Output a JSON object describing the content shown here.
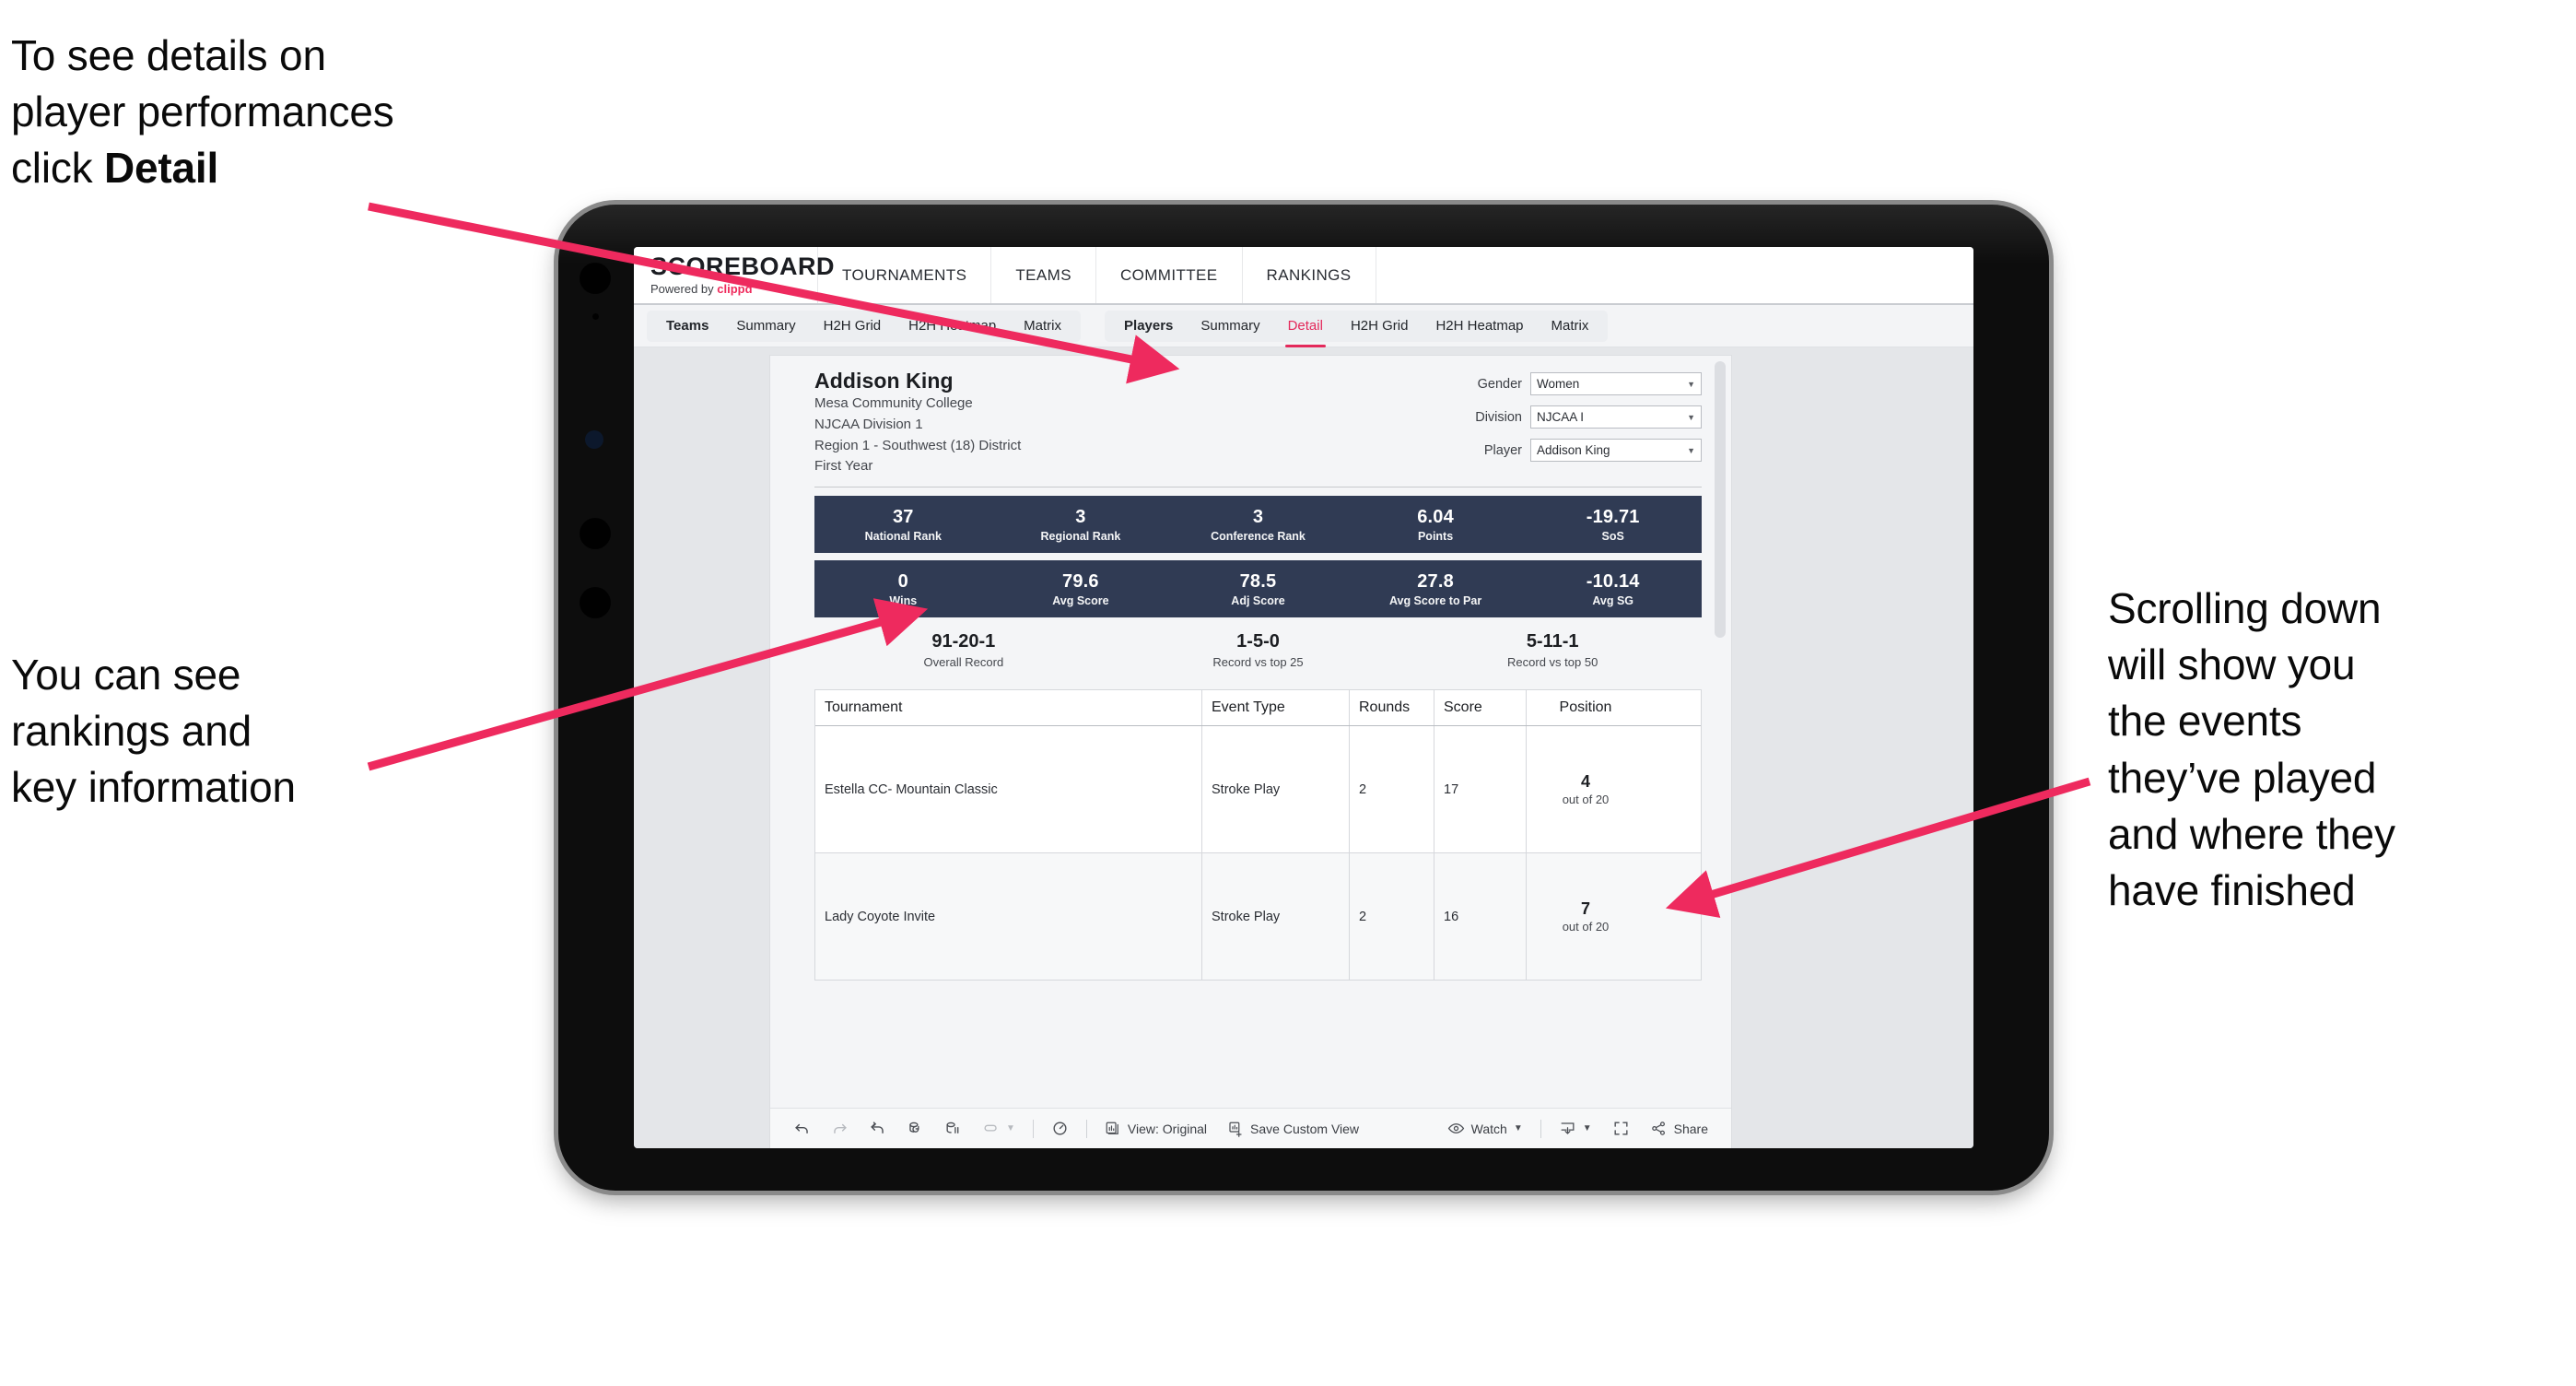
{
  "annotations": {
    "top_left": {
      "line1": "To see details on",
      "line2": "player performances",
      "line3_prefix": "click ",
      "line3_bold": "Detail"
    },
    "mid_left": {
      "line1": "You can see",
      "line2": "rankings and",
      "line3": "key information"
    },
    "right": {
      "line1": "Scrolling down",
      "line2": "will show you",
      "line3": "the events",
      "line4": "they’ve played",
      "line5": "and where they",
      "line6": "have finished"
    }
  },
  "colors": {
    "accent_pink": "#e4295b",
    "annotation_arrow": "#ee2a5e",
    "stat_bar_navy": "#303b54",
    "brand_link": "#ef2b5c"
  },
  "app": {
    "brand": {
      "title": "SCOREBOARD",
      "powered_prefix": "Powered by ",
      "powered_name": "clippd"
    },
    "top_nav": [
      {
        "label": "TOURNAMENTS"
      },
      {
        "label": "TEAMS"
      },
      {
        "label": "COMMITTEE"
      },
      {
        "label": "RANKINGS"
      }
    ],
    "sub_nav": {
      "group_teams": [
        {
          "label": "Teams",
          "active": false
        },
        {
          "label": "Summary",
          "active": false
        },
        {
          "label": "H2H Grid",
          "active": false
        },
        {
          "label": "H2H Heatmap",
          "active": false
        },
        {
          "label": "Matrix",
          "active": false
        }
      ],
      "group_players": [
        {
          "label": "Players",
          "active": false
        },
        {
          "label": "Summary",
          "active": false
        },
        {
          "label": "Detail",
          "active": true
        },
        {
          "label": "H2H Grid",
          "active": false
        },
        {
          "label": "H2H Heatmap",
          "active": false
        },
        {
          "label": "Matrix",
          "active": false
        }
      ]
    }
  },
  "player": {
    "name": "Addison King",
    "school": "Mesa Community College",
    "division": "NJCAA Division 1",
    "region": "Region 1 - Southwest (18) District",
    "year": "First Year"
  },
  "filters": [
    {
      "label": "Gender",
      "value": "Women"
    },
    {
      "label": "Division",
      "value": "NJCAA I"
    },
    {
      "label": "Player",
      "value": "Addison King"
    }
  ],
  "stats_row1": [
    {
      "value": "37",
      "label": "National Rank"
    },
    {
      "value": "3",
      "label": "Regional Rank"
    },
    {
      "value": "3",
      "label": "Conference Rank"
    },
    {
      "value": "6.04",
      "label": "Points"
    },
    {
      "value": "-19.71",
      "label": "SoS"
    }
  ],
  "stats_row2": [
    {
      "value": "0",
      "label": "Wins"
    },
    {
      "value": "79.6",
      "label": "Avg Score"
    },
    {
      "value": "78.5",
      "label": "Adj Score"
    },
    {
      "value": "27.8",
      "label": "Avg Score to Par"
    },
    {
      "value": "-10.14",
      "label": "Avg SG"
    }
  ],
  "records": [
    {
      "value": "91-20-1",
      "label": "Overall Record"
    },
    {
      "value": "1-5-0",
      "label": "Record vs top 25"
    },
    {
      "value": "5-11-1",
      "label": "Record vs top 50"
    }
  ],
  "table": {
    "columns": [
      "Tournament",
      "Event Type",
      "Rounds",
      "Score",
      "Position"
    ],
    "rows": [
      {
        "tournament": "Estella CC- Mountain Classic",
        "event_type": "Stroke Play",
        "rounds": "2",
        "score": "17",
        "position": "4",
        "position_sub": "out of 20"
      },
      {
        "tournament": "Lady Coyote Invite",
        "event_type": "Stroke Play",
        "rounds": "2",
        "score": "16",
        "position": "7",
        "position_sub": "out of 20"
      }
    ]
  },
  "viz_toolbar": {
    "view_label": "View: Original",
    "save_label": "Save Custom View",
    "watch_label": "Watch",
    "share_label": "Share"
  }
}
